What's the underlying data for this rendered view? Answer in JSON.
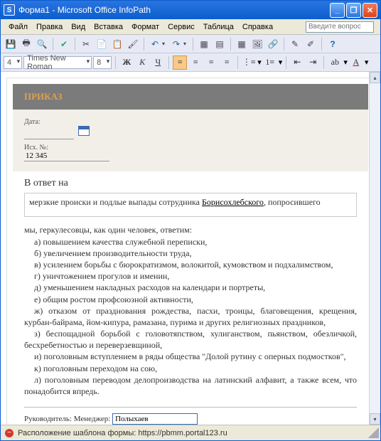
{
  "window": {
    "title": "Форма1 - Microsoft Office InfoPath",
    "app_icon": "S"
  },
  "menu": {
    "items": [
      "Файл",
      "Правка",
      "Вид",
      "Вставка",
      "Формат",
      "Сервис",
      "Таблица",
      "Справка"
    ],
    "question_placeholder": "Введите вопрос"
  },
  "format": {
    "font": "Times New Roman",
    "size": "8"
  },
  "document": {
    "header": "ПРИКАЗ",
    "date_label": "Дата:",
    "outnum_label": "Исх. №:",
    "outnum_value": "12 345",
    "response_label": "В ответ на",
    "response_text_pre": "мерзкие происки и подлые выпады сотрудника ",
    "response_text_u": "Борисохлебского",
    "response_text_post": ", попросившего",
    "intro": "мы, геркулесовцы, как один человек, ответим:",
    "items": [
      "а) повышением качества служебной переписки,",
      "б) увеличением производительности труда,",
      "в) усилением борьбы с бюрократизмом, волокитой, кумовством и подхалимством,",
      "г) уничтожением прогулов и именин,",
      "д) уменьшением накладных расходов на календари и портреты,",
      "е) общим ростом профсоюзной активности,",
      "ж) отказом от празднования рождества, пасхи, троицы, благовещения, крещения, курбан-байрама, йом-кипура, рамазана, пурима и других религиозных праздников,",
      "з) беспощадной борьбой с головотяпством, хулиганством, пьянством, обезличкой, бесхребетностью и переверзевщиной,",
      "и) поголовным вступлением в ряды общества \"Долой рутину с оперных подмостков\",",
      "к) поголовным переходом на сою,",
      "л) поголовным переводом делопроизводства на латинский алфавит, а также всем, что понадобится впредь."
    ],
    "manager_label": "Руководитель: Менеджер:",
    "manager_value": "Полыхаев"
  },
  "status": {
    "text": "Расположение шаблона формы: https://pbmm.portal123.ru"
  }
}
